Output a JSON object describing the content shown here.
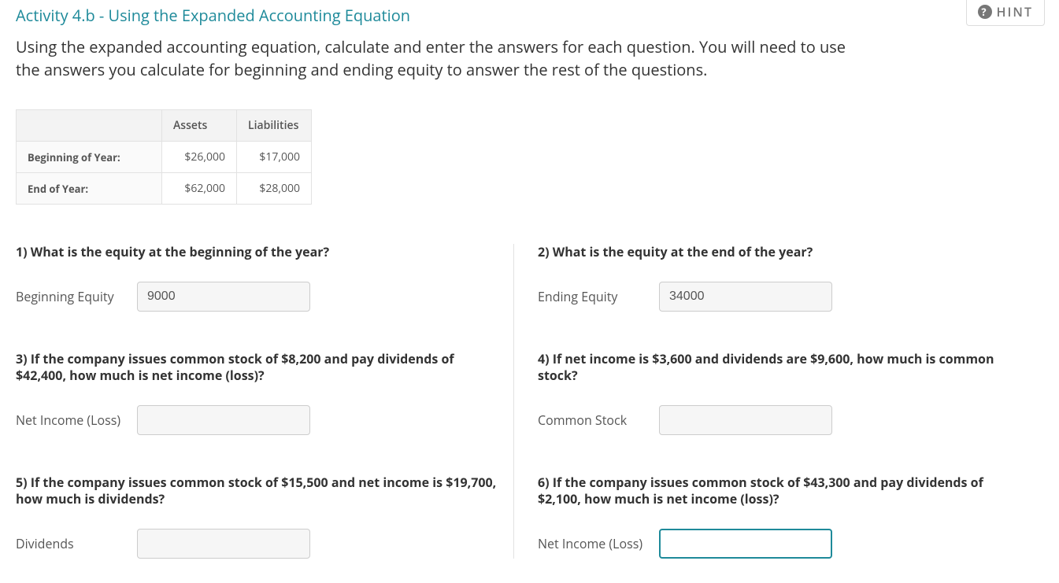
{
  "hint": {
    "label": "HINT",
    "icon": "?"
  },
  "activity_title": "Activity 4.b - Using the Expanded Accounting Equation",
  "instructions": "Using the expanded accounting equation, calculate and enter the answers for each question. You will need to use the answers you calculate for beginning and ending equity to answer the rest of the questions.",
  "table": {
    "headers": {
      "blank": "",
      "col1": "Assets",
      "col2": "Liabilities"
    },
    "rows": [
      {
        "label": "Beginning of Year:",
        "col1": "$26,000",
        "col2": "$17,000"
      },
      {
        "label": "End of Year:",
        "col1": "$62,000",
        "col2": "$28,000"
      }
    ]
  },
  "q1": {
    "text": "1) What is the equity at the beginning of the year?",
    "label": "Beginning Equity",
    "value": "9000"
  },
  "q2": {
    "text": "2) What is the equity at the end of the year?",
    "label": "Ending Equity",
    "value": "34000"
  },
  "q3": {
    "text": "3) If the company issues common stock of $8,200 and pay dividends of $42,400, how much is net income (loss)?",
    "label": "Net Income (Loss)",
    "value": ""
  },
  "q4": {
    "text": "4) If net income is $3,600 and dividends are $9,600, how much is common stock?",
    "label": "Common Stock",
    "value": ""
  },
  "q5": {
    "text": "5) If the company issues common stock of $15,500 and net income is $19,700, how much is dividends?",
    "label": "Dividends",
    "value": ""
  },
  "q6": {
    "text": "6) If the company issues common stock of $43,300 and pay dividends of $2,100, how much is net income (loss)?",
    "label": "Net Income (Loss)",
    "value": ""
  }
}
